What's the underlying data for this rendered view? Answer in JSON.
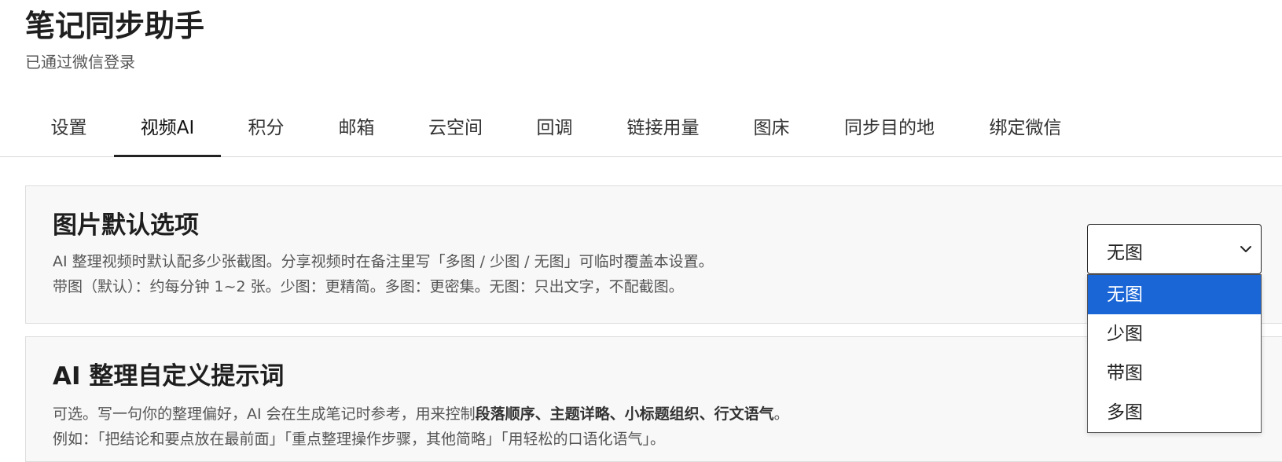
{
  "app": {
    "title": "笔记同步助手",
    "subtitle": "已通过微信登录"
  },
  "tabs": [
    {
      "label": "设置",
      "active": false
    },
    {
      "label": "视频AI",
      "active": true
    },
    {
      "label": "积分",
      "active": false
    },
    {
      "label": "邮箱",
      "active": false
    },
    {
      "label": "云空间",
      "active": false
    },
    {
      "label": "回调",
      "active": false
    },
    {
      "label": "链接用量",
      "active": false
    },
    {
      "label": "图床",
      "active": false
    },
    {
      "label": "同步目的地",
      "active": false
    },
    {
      "label": "绑定微信",
      "active": false
    }
  ],
  "image_options": {
    "title": "图片默认选项",
    "desc_line1": "AI 整理视频时默认配多少张截图。分享视频时在备注里写「多图 / 少图 / 无图」可临时覆盖本设置。",
    "desc_line2": "带图（默认）：约每分钟 1~2 张。少图：更精简。多图：更密集。无图：只出文字，不配截图。",
    "select": {
      "value": "无图",
      "options": [
        "无图",
        "少图",
        "带图",
        "多图"
      ],
      "highlighted": "无图"
    }
  },
  "prompt_section": {
    "title": "AI 整理自定义提示词",
    "desc_line1_prefix": "可选。写一句你的整理偏好，AI 会在生成笔记时参考，用来控制",
    "desc_line1_bold": "段落顺序、主题详略、小标题组织、行文语气",
    "desc_line1_suffix": "。",
    "desc_line2": "例如：「把结论和要点放在最前面」「重点整理操作步骤，其他简略」「用轻松的口语化语气」。"
  },
  "colors": {
    "accent": "#1a66d6",
    "card_bg": "#f8f8f8",
    "card_border": "#dedede"
  }
}
